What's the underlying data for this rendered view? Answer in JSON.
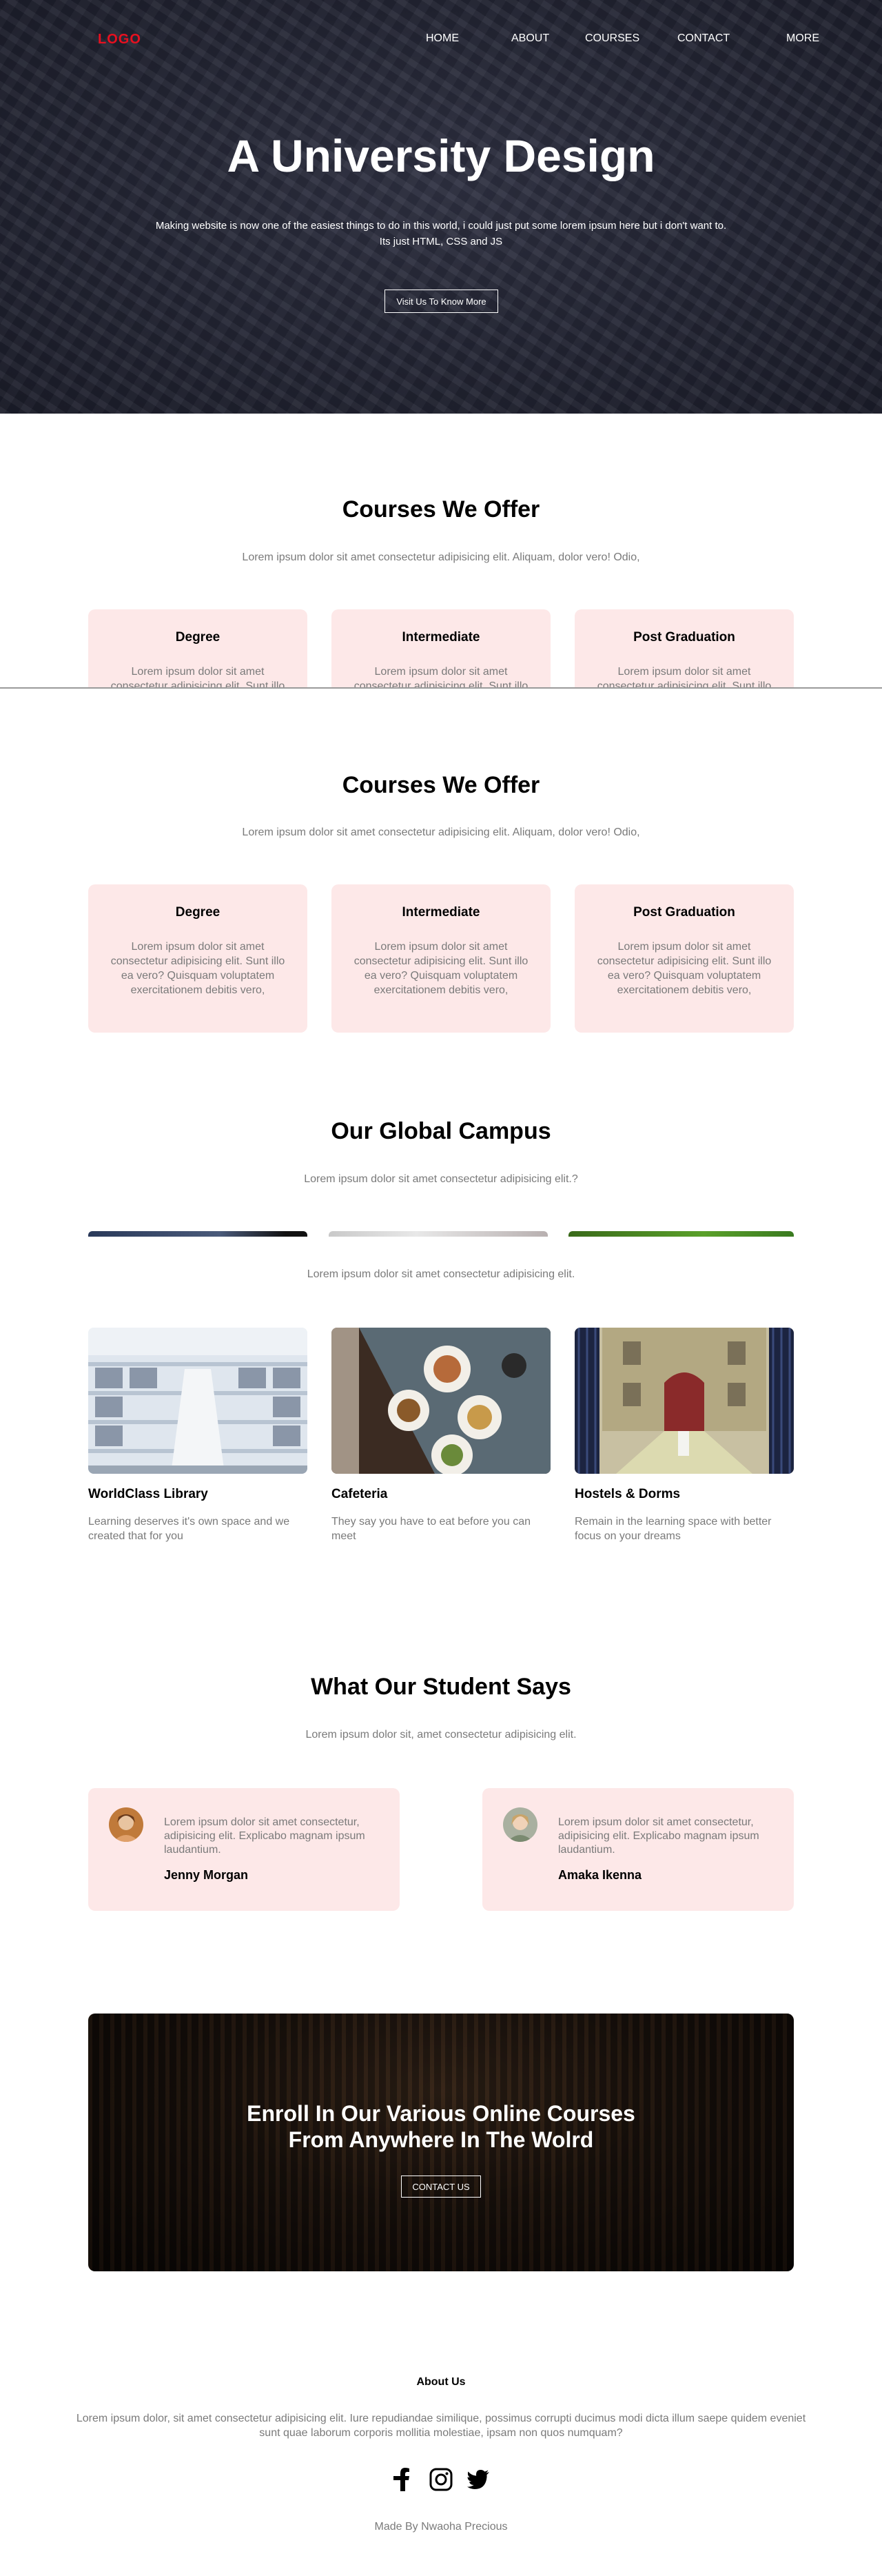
{
  "nav": {
    "logo": "LOGO",
    "links": [
      "HOME",
      "ABOUT",
      "COURSES",
      "CONTACT",
      "MORE"
    ]
  },
  "hero": {
    "title": "A University Design",
    "subtitle": "Making website is now one of the easiest things to do in this world, i could just put some lorem ipsum here but i don't want to. Its just HTML, CSS and JS",
    "button": "Visit Us To Know More"
  },
  "courses": {
    "title": "Courses We Offer",
    "subtitle": "Lorem ipsum dolor sit amet consectetur adipisicing elit. Aliquam, dolor vero! Odio,",
    "cards": [
      {
        "title": "Degree",
        "text": "Lorem ipsum dolor sit amet consectetur adipisicing elit. Sunt illo ea vero? Quisquam voluptatem exercitationem debitis vero,"
      },
      {
        "title": "Intermediate",
        "text": "Lorem ipsum dolor sit amet consectetur adipisicing elit. Sunt illo ea vero? Quisquam voluptatem exercitationem debitis vero,"
      },
      {
        "title": "Post Graduation",
        "text": "Lorem ipsum dolor sit amet consectetur adipisicing elit. Sunt illo ea vero? Quisquam voluptatem exercitationem debitis vero,"
      }
    ]
  },
  "campus": {
    "title": "Our Global Campus",
    "subtitle": "Lorem ipsum dolor sit amet consectetur adipisicing elit.?"
  },
  "facilities": {
    "subtitle": "Lorem ipsum dolor sit amet consectetur adipisicing elit.",
    "items": [
      {
        "title": "WorldClass Library",
        "desc": "Learning deserves it's own space and we created that for you"
      },
      {
        "title": "Cafeteria",
        "desc": "They say you have to eat before you can meet"
      },
      {
        "title": "Hostels & Dorms",
        "desc": "Remain in the learning space with better focus on your dreams"
      }
    ]
  },
  "testimonials": {
    "title": "What Our Student Says",
    "subtitle": "Lorem ipsum dolor sit, amet consectetur adipisicing elit.",
    "items": [
      {
        "quote": "Lorem ipsum dolor sit amet consectetur, adipisicing elit. Explicabo magnam ipsum laudantium.",
        "name": "Jenny Morgan"
      },
      {
        "quote": "Lorem ipsum dolor sit amet consectetur, adipisicing elit. Explicabo magnam ipsum laudantium.",
        "name": "Amaka Ikenna"
      }
    ]
  },
  "cta": {
    "title_line1": "Enroll In Our Various Online Courses",
    "title_line2": "From Anywhere In The Wolrd",
    "button": "CONTACT US"
  },
  "footer": {
    "title": "About Us",
    "text": "Lorem ipsum dolor, sit amet consectetur adipisicing elit. Iure repudiandae similique, possimus corrupti ducimus modi dicta illum saepe quidem eveniet sunt quae laborum corporis mollitia molestiae, ipsam non quos numquam?",
    "social_icons": [
      "facebook-icon",
      "instagram-icon",
      "twitter-icon"
    ],
    "credit": "Made By Nwaoha Precious"
  },
  "colors": {
    "logo": "#e8101f",
    "card_bg": "#fde8e8",
    "muted_text": "#7a7a7a"
  }
}
